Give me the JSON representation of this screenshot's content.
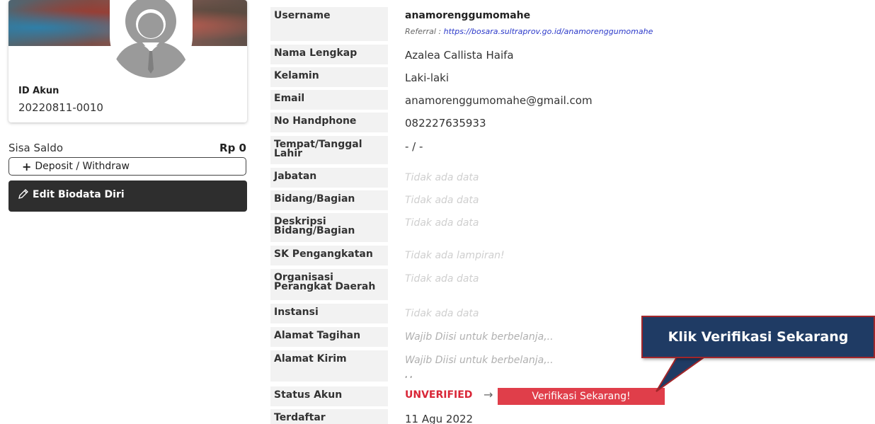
{
  "profile": {
    "id_label": "ID Akun",
    "id_value": "20220811-0010"
  },
  "balance": {
    "label": "Sisa Saldo",
    "value": "Rp 0"
  },
  "buttons": {
    "deposit_label": "Deposit / Withdraw",
    "edit_label": "Edit Biodata Diri",
    "verify_label": "Verifikasi Sekarang!"
  },
  "details": {
    "username": {
      "label": "Username",
      "value": "anamorenggumomahe"
    },
    "referral": {
      "prefix": "Referral :",
      "url": "https://bosara.sultraprov.go.id/anamorenggumomahe"
    },
    "full_name": {
      "label": "Nama Lengkap",
      "value": "Azalea Callista Haifa"
    },
    "gender": {
      "label": "Kelamin",
      "value": "Laki-laki"
    },
    "email": {
      "label": "Email",
      "value": "anamorenggumomahe@gmail.com"
    },
    "phone": {
      "label": "No Handphone",
      "value": "082227635933"
    },
    "birth": {
      "label_line1": "Tempat/Tanggal",
      "label_line2": "Lahir",
      "value": "- / -"
    },
    "position": {
      "label": "Jabatan",
      "value": "Tidak ada data"
    },
    "division": {
      "label": "Bidang/Bagian",
      "value": "Tidak ada data"
    },
    "division_desc": {
      "label_line1": "Deskripsi",
      "label_line2": "Bidang/Bagian",
      "value": "Tidak ada data"
    },
    "appointment": {
      "label": "SK Pengangkatan",
      "value": "Tidak ada lampiran!"
    },
    "organization": {
      "label_line1": "Organisasi",
      "label_line2": "Perangkat Daerah",
      "value": "Tidak ada data"
    },
    "agency": {
      "label": "Instansi",
      "value": "Tidak ada data"
    },
    "billing_address": {
      "label": "Alamat Tagihan",
      "value": "Wajib Diisi untuk berbelanja,.."
    },
    "shipping_address": {
      "label": "Alamat Kirim",
      "value": "Wajib Diisi untuk berbelanja,..",
      "extra": ", ,"
    },
    "status": {
      "label": "Status Akun",
      "value": "UNVERIFIED",
      "arrow": "→"
    },
    "registered": {
      "label": "Terdaftar",
      "value": "11 Agu 2022"
    }
  },
  "callout": {
    "text": "Klik Verifikasi Sekarang"
  },
  "colors": {
    "unverified": "#d92637",
    "verify_button": "#e03e4a",
    "callout_bg": "#1f3b64",
    "callout_border": "#a2262a",
    "edit_button": "#2e2e2e"
  },
  "icons": {
    "avatar": "avatar-silhouette-icon",
    "deposit": "plus-icon",
    "edit": "pencil-icon",
    "arrow": "arrow-right-icon"
  }
}
